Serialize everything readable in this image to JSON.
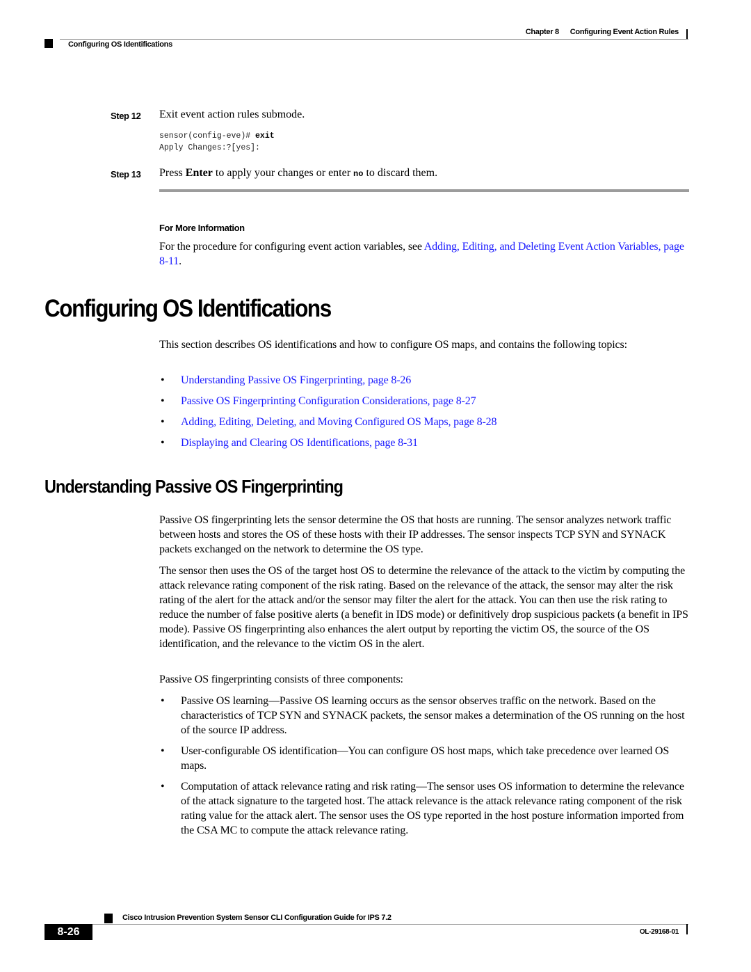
{
  "header": {
    "chapter_label": "Chapter 8",
    "chapter_title": "Configuring Event Action Rules",
    "section_title": "Configuring OS Identifications"
  },
  "steps": [
    {
      "label": "Step 12",
      "text": "Exit event action rules submode.",
      "code": {
        "prompt": "sensor(config-eve)# ",
        "command": "exit",
        "output": "Apply Changes:?[yes]:"
      }
    },
    {
      "label": "Step 13",
      "text_before": "Press ",
      "bold": "Enter",
      "text_middle": " to apply your changes or enter ",
      "code": "no",
      "text_after": " to discard them."
    }
  ],
  "for_more_information": {
    "heading": "For More Information",
    "text": "For the procedure for configuring event action variables, see ",
    "link": "Adding, Editing, and Deleting Event Action Variables, page 8-11",
    "text_after": "."
  },
  "section": {
    "title": "Configuring OS Identifications",
    "intro": "This section describes OS identifications and how to configure OS maps, and contains the following topics:",
    "bullet_symbol": "•",
    "topics": [
      "Understanding Passive OS Fingerprinting, page 8-26",
      "Passive OS Fingerprinting Configuration Considerations, page 8-27",
      "Adding, Editing, Deleting, and Moving Configured OS Maps, page 8-28",
      "Displaying and Clearing OS Identifications, page 8-31"
    ]
  },
  "subsection": {
    "title": "Understanding Passive OS Fingerprinting",
    "paragraphs": [
      "Passive OS fingerprinting lets the sensor determine the OS that hosts are running. The sensor analyzes network traffic between hosts and stores the OS of these hosts with their IP addresses. The sensor inspects TCP SYN and SYNACK packets exchanged on the network to determine the OS type.",
      "The sensor then uses the OS of the target host OS to determine the relevance of the attack to the victim by computing the attack relevance rating component of the risk rating. Based on the relevance of the attack, the sensor may alter the risk rating of the alert for the attack and/or the sensor may filter the alert for the attack. You can then use the risk rating to reduce the number of false positive alerts (a benefit in IDS mode) or definitively drop suspicious packets (a benefit in IPS mode). Passive OS fingerprinting also enhances the alert output by reporting the victim OS, the source of the OS identification, and the relevance to the victim OS in the alert.",
      "Passive OS fingerprinting consists of three components:"
    ],
    "components": [
      "Passive OS learning—Passive OS learning occurs as the sensor observes traffic on the network. Based on the characteristics of TCP SYN and SYNACK packets, the sensor makes a determination of the OS running on the host of the source IP address.",
      "User-configurable OS identification—You can configure OS host maps, which take precedence over learned OS maps.",
      "Computation of attack relevance rating and risk rating—The sensor uses OS information to determine the relevance of the attack signature to the targeted host. The attack relevance is the attack relevance rating component of the risk rating value for the attack alert. The sensor uses the OS type reported in the host posture information imported from the CSA MC to compute the attack relevance rating."
    ]
  },
  "footer": {
    "book_title": "Cisco Intrusion Prevention System Sensor CLI Configuration Guide for IPS 7.2",
    "page_number": "8-26",
    "doc_id": "OL-29168-01"
  },
  "colors": {
    "link": "#1a1aff",
    "rule": "#9c9c9c"
  }
}
